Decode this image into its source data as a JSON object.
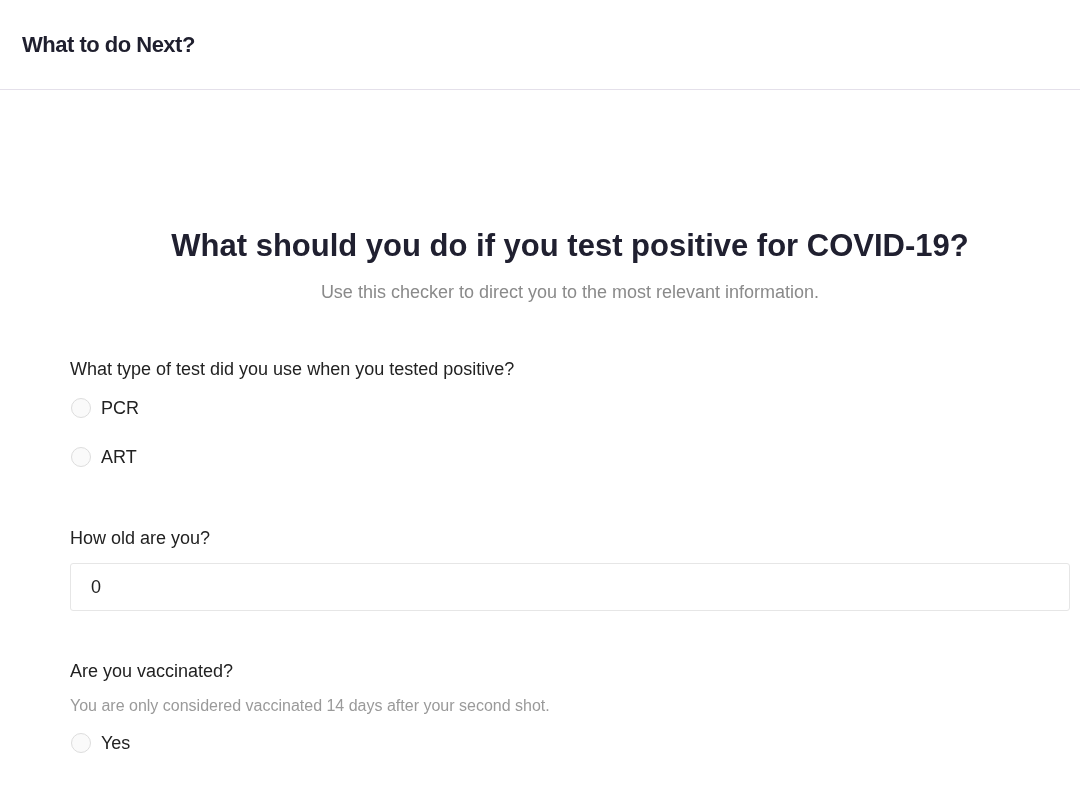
{
  "header": {
    "title": "What to do Next?"
  },
  "heading": "What should you do if you test positive for COVID-19?",
  "subtitle": "Use this checker to direct you to the most relevant information.",
  "questions": [
    {
      "kind": "radio",
      "label": "What type of test did you use when you tested positive?",
      "options": [
        {
          "label": "PCR",
          "selected": false
        },
        {
          "label": "ART",
          "selected": false
        }
      ]
    },
    {
      "kind": "number",
      "label": "How old are you?",
      "value": "0"
    },
    {
      "kind": "radio",
      "label": "Are you vaccinated?",
      "hint": "You are only considered vaccinated 14 days after your second shot.",
      "options": [
        {
          "label": "Yes",
          "selected": false
        }
      ]
    }
  ]
}
